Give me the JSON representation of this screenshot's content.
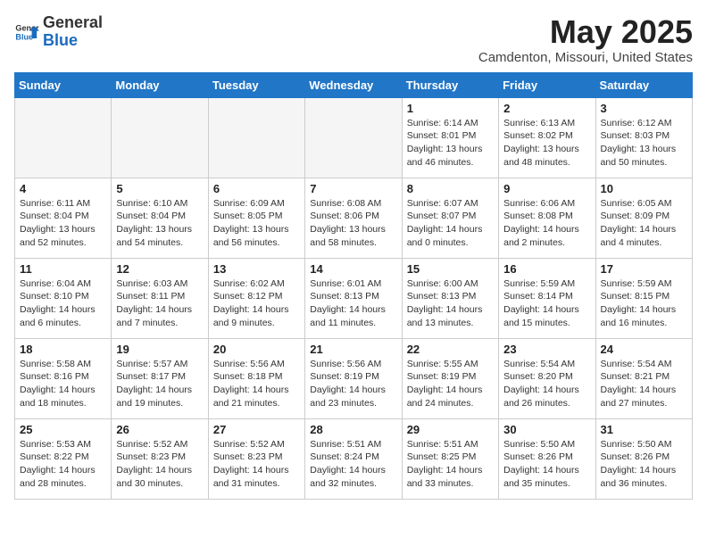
{
  "header": {
    "logo_general": "General",
    "logo_blue": "Blue",
    "month_title": "May 2025",
    "location": "Camdenton, Missouri, United States"
  },
  "days_of_week": [
    "Sunday",
    "Monday",
    "Tuesday",
    "Wednesday",
    "Thursday",
    "Friday",
    "Saturday"
  ],
  "weeks": [
    [
      {
        "day": "",
        "info": ""
      },
      {
        "day": "",
        "info": ""
      },
      {
        "day": "",
        "info": ""
      },
      {
        "day": "",
        "info": ""
      },
      {
        "day": "1",
        "info": "Sunrise: 6:14 AM\nSunset: 8:01 PM\nDaylight: 13 hours\nand 46 minutes."
      },
      {
        "day": "2",
        "info": "Sunrise: 6:13 AM\nSunset: 8:02 PM\nDaylight: 13 hours\nand 48 minutes."
      },
      {
        "day": "3",
        "info": "Sunrise: 6:12 AM\nSunset: 8:03 PM\nDaylight: 13 hours\nand 50 minutes."
      }
    ],
    [
      {
        "day": "4",
        "info": "Sunrise: 6:11 AM\nSunset: 8:04 PM\nDaylight: 13 hours\nand 52 minutes."
      },
      {
        "day": "5",
        "info": "Sunrise: 6:10 AM\nSunset: 8:04 PM\nDaylight: 13 hours\nand 54 minutes."
      },
      {
        "day": "6",
        "info": "Sunrise: 6:09 AM\nSunset: 8:05 PM\nDaylight: 13 hours\nand 56 minutes."
      },
      {
        "day": "7",
        "info": "Sunrise: 6:08 AM\nSunset: 8:06 PM\nDaylight: 13 hours\nand 58 minutes."
      },
      {
        "day": "8",
        "info": "Sunrise: 6:07 AM\nSunset: 8:07 PM\nDaylight: 14 hours\nand 0 minutes."
      },
      {
        "day": "9",
        "info": "Sunrise: 6:06 AM\nSunset: 8:08 PM\nDaylight: 14 hours\nand 2 minutes."
      },
      {
        "day": "10",
        "info": "Sunrise: 6:05 AM\nSunset: 8:09 PM\nDaylight: 14 hours\nand 4 minutes."
      }
    ],
    [
      {
        "day": "11",
        "info": "Sunrise: 6:04 AM\nSunset: 8:10 PM\nDaylight: 14 hours\nand 6 minutes."
      },
      {
        "day": "12",
        "info": "Sunrise: 6:03 AM\nSunset: 8:11 PM\nDaylight: 14 hours\nand 7 minutes."
      },
      {
        "day": "13",
        "info": "Sunrise: 6:02 AM\nSunset: 8:12 PM\nDaylight: 14 hours\nand 9 minutes."
      },
      {
        "day": "14",
        "info": "Sunrise: 6:01 AM\nSunset: 8:13 PM\nDaylight: 14 hours\nand 11 minutes."
      },
      {
        "day": "15",
        "info": "Sunrise: 6:00 AM\nSunset: 8:13 PM\nDaylight: 14 hours\nand 13 minutes."
      },
      {
        "day": "16",
        "info": "Sunrise: 5:59 AM\nSunset: 8:14 PM\nDaylight: 14 hours\nand 15 minutes."
      },
      {
        "day": "17",
        "info": "Sunrise: 5:59 AM\nSunset: 8:15 PM\nDaylight: 14 hours\nand 16 minutes."
      }
    ],
    [
      {
        "day": "18",
        "info": "Sunrise: 5:58 AM\nSunset: 8:16 PM\nDaylight: 14 hours\nand 18 minutes."
      },
      {
        "day": "19",
        "info": "Sunrise: 5:57 AM\nSunset: 8:17 PM\nDaylight: 14 hours\nand 19 minutes."
      },
      {
        "day": "20",
        "info": "Sunrise: 5:56 AM\nSunset: 8:18 PM\nDaylight: 14 hours\nand 21 minutes."
      },
      {
        "day": "21",
        "info": "Sunrise: 5:56 AM\nSunset: 8:19 PM\nDaylight: 14 hours\nand 23 minutes."
      },
      {
        "day": "22",
        "info": "Sunrise: 5:55 AM\nSunset: 8:19 PM\nDaylight: 14 hours\nand 24 minutes."
      },
      {
        "day": "23",
        "info": "Sunrise: 5:54 AM\nSunset: 8:20 PM\nDaylight: 14 hours\nand 26 minutes."
      },
      {
        "day": "24",
        "info": "Sunrise: 5:54 AM\nSunset: 8:21 PM\nDaylight: 14 hours\nand 27 minutes."
      }
    ],
    [
      {
        "day": "25",
        "info": "Sunrise: 5:53 AM\nSunset: 8:22 PM\nDaylight: 14 hours\nand 28 minutes."
      },
      {
        "day": "26",
        "info": "Sunrise: 5:52 AM\nSunset: 8:23 PM\nDaylight: 14 hours\nand 30 minutes."
      },
      {
        "day": "27",
        "info": "Sunrise: 5:52 AM\nSunset: 8:23 PM\nDaylight: 14 hours\nand 31 minutes."
      },
      {
        "day": "28",
        "info": "Sunrise: 5:51 AM\nSunset: 8:24 PM\nDaylight: 14 hours\nand 32 minutes."
      },
      {
        "day": "29",
        "info": "Sunrise: 5:51 AM\nSunset: 8:25 PM\nDaylight: 14 hours\nand 33 minutes."
      },
      {
        "day": "30",
        "info": "Sunrise: 5:50 AM\nSunset: 8:26 PM\nDaylight: 14 hours\nand 35 minutes."
      },
      {
        "day": "31",
        "info": "Sunrise: 5:50 AM\nSunset: 8:26 PM\nDaylight: 14 hours\nand 36 minutes."
      }
    ]
  ]
}
